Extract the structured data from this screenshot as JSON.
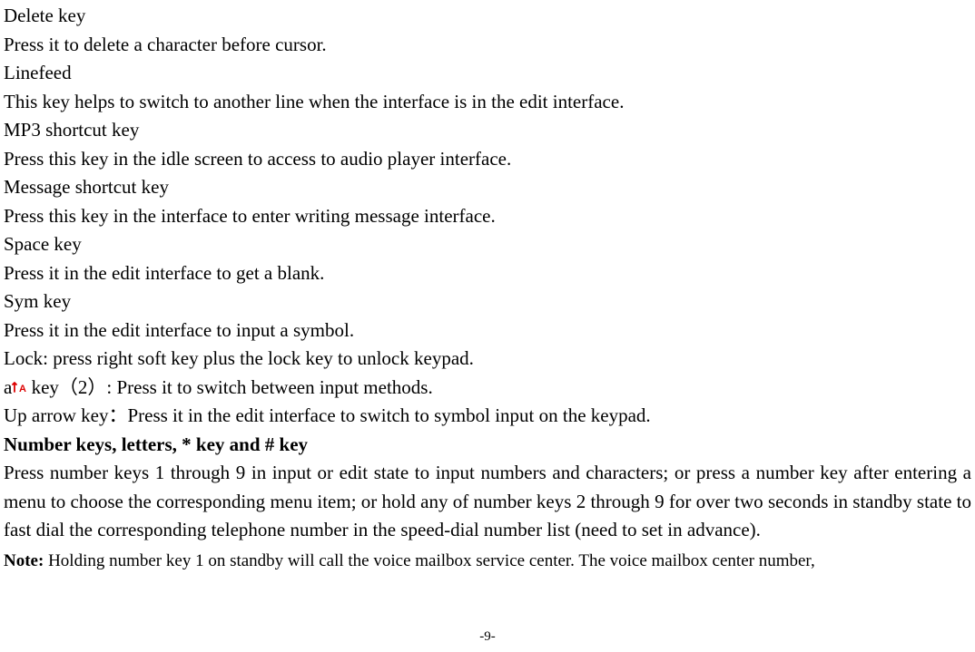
{
  "lines": {
    "deleteKeyTitle": "Delete key",
    "deleteKeyDesc": "Press it to delete a character before cursor.",
    "linefeedTitle": "Linefeed",
    "linefeedDesc": "This key helps to switch to another line when the interface is in the edit interface.",
    "mp3Title": "MP3 shortcut key",
    "mp3Desc": "Press this key in the idle screen to access to audio player interface.",
    "messageTitle": "Message shortcut key",
    "messageDesc": "Press this key in the interface to enter writing message interface.",
    "spaceTitle": "Space key",
    "spaceDesc": "Press it in the edit interface to get a blank.",
    "symTitle": "Sym key",
    "symDesc": "Press it in the edit interface to input a symbol.",
    "lockDesc": "Lock: press right soft key plus the lock key to unlock keypad.",
    "aKeyPrefix": "a",
    "aKeySuffix": " key（2）: Press it to switch between input methods.",
    "upArrowDesc": "Up arrow key：Press it in the edit interface to switch to symbol input on the keypad.",
    "numberKeysHeading": "Number keys, letters, * key and # key",
    "numberKeysPara": "Press number keys 1 through 9 in input or edit state to input numbers and characters; or press a number key after entering a menu to choose the corresponding menu item; or hold any of number keys 2 through 9 for over two seconds in standby state to fast dial the corresponding telephone number in the speed-dial number list (need to set in advance).",
    "noteLabel": "Note:",
    "noteText": " Holding number key 1 on standby will call the voice mailbox service center. The voice mailbox center number,"
  },
  "pageNumber": "-9-"
}
